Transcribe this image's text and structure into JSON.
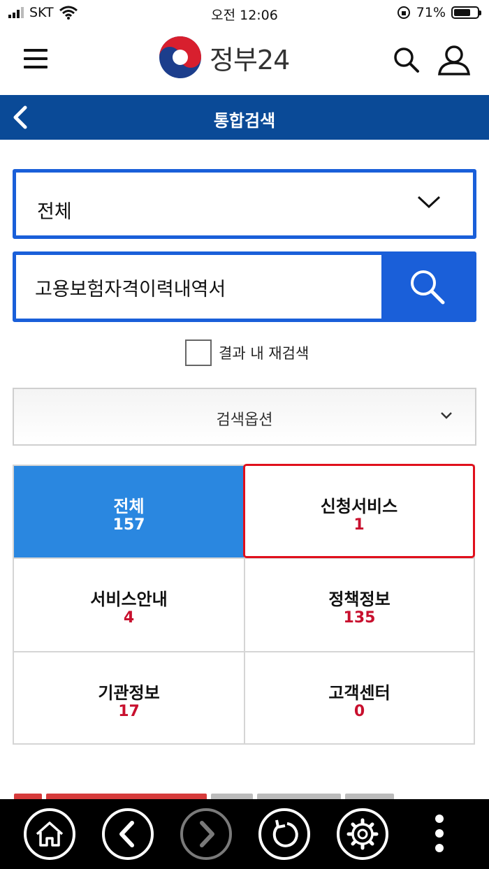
{
  "status_bar": {
    "carrier": "SKT",
    "time": "오전 12:06",
    "battery_percent": "71%",
    "battery_level": 0.71
  },
  "header": {
    "logo_text": "정부24",
    "icons": [
      "menu-icon",
      "search-icon",
      "user-icon"
    ]
  },
  "nav": {
    "title": "통합검색"
  },
  "search": {
    "category_value": "전체",
    "query": "고용보험자격이력내역서",
    "recheck_label": "결과 내 재검색",
    "options_label": "검색옵션"
  },
  "results": {
    "tabs": [
      {
        "label": "전체",
        "count": "157"
      },
      {
        "label": "신청서비스",
        "count": "1"
      },
      {
        "label": "서비스안내",
        "count": "4"
      },
      {
        "label": "정책정보",
        "count": "135"
      },
      {
        "label": "기관정보",
        "count": "17"
      },
      {
        "label": "고객센터",
        "count": "0"
      }
    ]
  },
  "colors": {
    "nav_bar": "#0a4a97",
    "accent_blue": "#1a5fd9",
    "active_tab": "#2a87e0",
    "count_red": "#c8102e",
    "selected_border": "#e0101c"
  },
  "toolbar": {
    "buttons": [
      "home-icon",
      "back-icon",
      "forward-icon",
      "reload-icon",
      "settings-icon",
      "more-icon"
    ]
  }
}
